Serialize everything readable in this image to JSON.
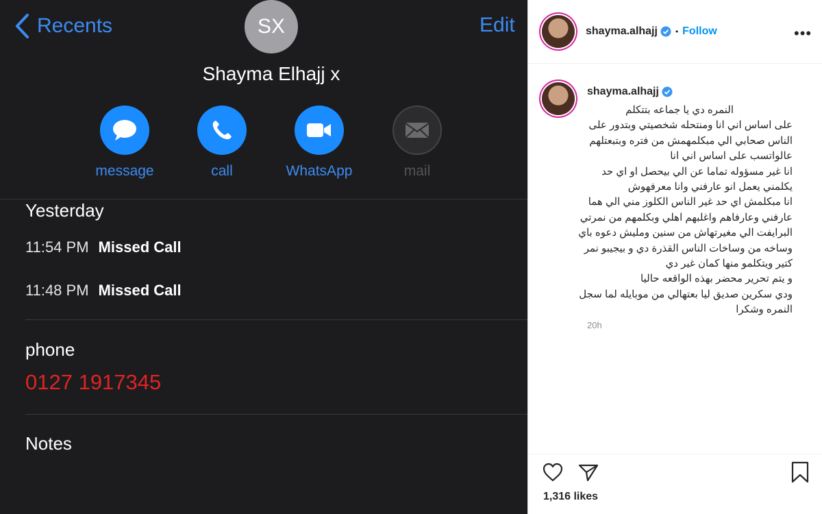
{
  "contact": {
    "back_label": "Recents",
    "edit_label": "Edit",
    "initials": "SX",
    "name": "Shayma Elhajj x",
    "actions": [
      {
        "label": "message",
        "icon": "message-bubble-icon",
        "enabled": true
      },
      {
        "label": "call",
        "icon": "phone-icon",
        "enabled": true
      },
      {
        "label": "WhatsApp",
        "icon": "video-icon",
        "enabled": true
      },
      {
        "label": "mail",
        "icon": "envelope-icon",
        "enabled": false
      }
    ],
    "history_header": "Yesterday",
    "calls": [
      {
        "time": "11:54 PM",
        "status": "Missed Call"
      },
      {
        "time": "11:48 PM",
        "status": "Missed Call"
      }
    ],
    "phone_label": "phone",
    "phone_number": "0127 1917345",
    "notes_label": "Notes"
  },
  "instagram": {
    "username": "shayma.alhajj",
    "follow_label": "Follow",
    "separator": "•",
    "more_label": "•••",
    "caption_lines": [
      "النمره دي يا جماعه بتتكلم",
      "على اساس اني انا ومنتحله شخصيتي وبتدور على",
      "الناس صحابي الي مبكلمهمش من فتره وبتبعتلهم",
      "عالواتسب على اساس اني انا",
      "انا غير مسؤوله تماما عن الي بيحصل او اي حد",
      "يكلمني يعمل انو عارفني وانا معرفهوش",
      "انا مبكلمش اي حد غير الناس الكلوز مني الي هما",
      "عارفني وعارفاهم واغلبهم اهلي وبكلمهم من نمرتي",
      "البرايفت الي مغيرتهاش من سنين ومليش دعوه باي",
      "وساخه من وساخات الناس القذرة دي و بيجيبو نمر",
      "كتير ويتكلمو منها كمان غير دي",
      "و يتم تحرير محضر بهذه الواقعه حاليا",
      "ودي سكرين صديق ليا بعتهالي من موبايله لما سجل",
      "النمره وشكرا"
    ],
    "time_ago": "20h",
    "likes": "1,316 likes",
    "colors": {
      "link": "#0095f6",
      "text": "#262626",
      "muted": "#8e8e8e"
    }
  },
  "colors": {
    "ios_bg": "#1c1c1e",
    "ios_blue": "#3d8bf2",
    "missed_red": "#e02323"
  }
}
